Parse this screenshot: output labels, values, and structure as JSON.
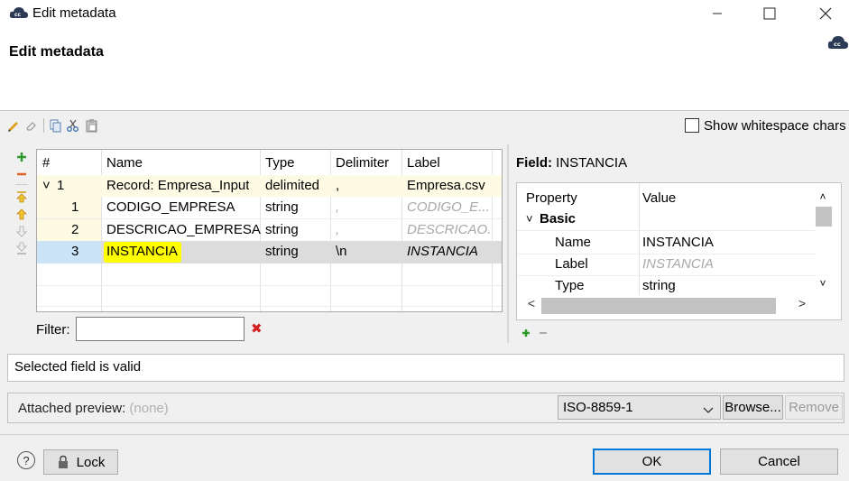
{
  "window": {
    "title": "Edit metadata",
    "minimize_glyph": "—",
    "maximize_glyph": "☐",
    "close_glyph": "✕"
  },
  "header": {
    "title": "Edit metadata",
    "logo_text": "cc"
  },
  "toolbar": {
    "icons": [
      "edit-icon",
      "clear-icon",
      "copy-icon",
      "cut-icon",
      "paste-icon"
    ],
    "show_whitespace_label": "Show whitespace chars",
    "show_whitespace_checked": false
  },
  "side_buttons": [
    "add-icon",
    "remove-icon",
    "move-top-icon",
    "move-up-icon",
    "move-down-icon",
    "move-bottom-icon"
  ],
  "table": {
    "columns": [
      "#",
      "Name",
      "Type",
      "Delimiter",
      "Label"
    ],
    "record": {
      "num": "1",
      "name": "Record: Empresa_Input",
      "type": "delimited",
      "delimiter": ",",
      "label": "Empresa.csv",
      "expander": "˅"
    },
    "rows": [
      {
        "num": "1",
        "name": "CODIGO_EMPRESA",
        "type": "string",
        "delimiter": ",",
        "label": "CODIGO_E..."
      },
      {
        "num": "2",
        "name": "DESCRICAO_EMPRESA",
        "type": "string",
        "delimiter": ",",
        "label": "DESCRICAO..."
      },
      {
        "num": "3",
        "name": "INSTANCIA",
        "type": "string",
        "delimiter": "\\n",
        "label": "INSTANCIA"
      }
    ],
    "selected_row": 3
  },
  "filter": {
    "label": "Filter:",
    "value": "",
    "clear_glyph": "✖"
  },
  "field_panel": {
    "title_prefix": "Field:",
    "title_value": "INSTANCIA",
    "columns": [
      "Property",
      "Value"
    ],
    "group": "Basic",
    "group_expander": "˅",
    "properties": [
      {
        "name": "Name",
        "value": "INSTANCIA"
      },
      {
        "name": "Label",
        "value": "INSTANCIA"
      },
      {
        "name": "Type",
        "value": "string"
      }
    ],
    "scroll_up": "˄",
    "scroll_down": "˅",
    "scroll_left": "<",
    "scroll_right": ">"
  },
  "status": {
    "text": "Selected field is valid"
  },
  "preview": {
    "label": "Attached preview:",
    "value": "(none)",
    "encoding": "ISO-8859-1",
    "browse_label": "Browse...",
    "remove_label": "Remove"
  },
  "footer": {
    "help_glyph": "?",
    "lock_label": "Lock",
    "ok_label": "OK",
    "cancel_label": "Cancel"
  },
  "colors": {
    "accent_blue": "#0078d7",
    "selected_row": "#dcdcdc",
    "record_row": "#fdfbe3",
    "highlight": "#ffff00",
    "add_green": "#2e9a2e",
    "remove_orange": "#e06020"
  }
}
